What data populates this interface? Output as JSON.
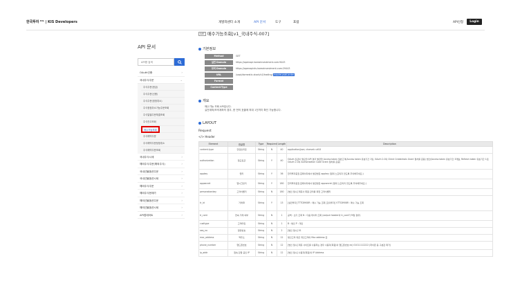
{
  "header": {
    "brand": "한국투자 ᴷᴵˢ | KIS Developers",
    "nav": [
      {
        "label": "개발자센터 소개",
        "active": false
      },
      {
        "label": "API 문서",
        "active": true
      },
      {
        "label": "도구",
        "active": false
      },
      {
        "label": "포럼",
        "active": false
      }
    ],
    "api_apply": "API신청",
    "login": "Login"
  },
  "sidebar": {
    "title": "API 문서",
    "search_placeholder": "API명 검색",
    "items": [
      {
        "label": "OAuth인증"
      },
      {
        "label": "국내주식주문",
        "expanded": true,
        "children": [
          "주식주문(현금)",
          "주식주문(신용)",
          "주식주문(정정취소)",
          "주식정정취소가능주문조회",
          "주식일별주문체결조회",
          "주식잔고조회",
          "매수가능조회",
          "주식예약주문",
          "주식예약주문정정취소",
          "주식예약주문조회"
        ]
      },
      {
        "label": "국내주식시세"
      },
      {
        "label": "해외주식주문(해외주식)"
      },
      {
        "label": "국내선물옵션주문"
      },
      {
        "label": "국내선물옵션시세"
      },
      {
        "label": "해외주식주문"
      },
      {
        "label": "해외주식현재가"
      },
      {
        "label": "해외선물옵션주문"
      },
      {
        "label": "해외선물옵션시세"
      },
      {
        "label": "API업데이트"
      }
    ],
    "selected_child": "매수가능조회"
  },
  "content": {
    "title_tag": "GET",
    "title": "매수가능조회[v1_국내주식-007]",
    "basic_info_heading": "기본정보",
    "info": [
      {
        "label": "Method",
        "value": "GET"
      },
      {
        "label": "실전 Domain",
        "value": "https://openapi.koreainvestment.com:9443"
      },
      {
        "label": "모의 Domain",
        "value": "https://openapivts.koreainvestment.com:29443"
      },
      {
        "label": "URL",
        "value": "/uapi/domestic-stock/v1/trading/",
        "highlight": "inquire-psbl-order"
      },
      {
        "label": "Format",
        "value": ""
      },
      {
        "label": "Content-Type",
        "value": ""
      }
    ],
    "summary_heading": "개요",
    "summary_lines": [
      "매수가능 조회 API입니다.",
      "실전계좌/모의계좌의 경우, 한 번의 호출에 최대 1건까지 확인 가능합니다."
    ],
    "layout_heading": "LAYOUT",
    "request_label": "Request",
    "header_label": "Header",
    "table": {
      "columns": [
        "Element",
        "한글명",
        "Type",
        "Required",
        "Length",
        "Description"
      ],
      "rows": [
        [
          "content-type",
          "컨텐츠타입",
          "String",
          "N",
          "40",
          "application/json; charset=utf-8"
        ],
        [
          "authorization",
          "접근토큰",
          "String",
          "Y",
          "40",
          "OAuth 토큰이 필요한 API 경우 발급한 Access token 일반고객(Access token 유효기간 1일, OAuth 2.0의 Client Credentials Grant 절차를 준용) 법인(Access token 유효기간 3개월, Refresh token 유효기간 1년, OAuth 2.0의 Authorization Code Grant 절차를 준용)"
        ],
        [
          "appkey",
          "앱키",
          "String",
          "Y",
          "36",
          "한국투자증권 홈페이지에서 발급받은 appkey (절대 노출되지 않도록 주의해주세요.)"
        ],
        [
          "appsecret",
          "앱시크릿키",
          "String",
          "Y",
          "180",
          "한국투자증권 홈페이지에서 발급받은 appsecret (절대 노출되지 않도록 주의해주세요.)"
        ],
        [
          "personalseckey",
          "고객식별키",
          "String",
          "N",
          "180",
          "[법인 필수] 제휴사 회원 관리를 위한 고객식별키"
        ],
        [
          "tr_id",
          "거래ID",
          "String",
          "Y",
          "13",
          "[실전투자] TTTC8908R : 매수 가능 조회 [모의투자] VTTC8908R : 매수 가능 조회"
        ],
        [
          "tr_cont",
          "연속 거래 여부",
          "String",
          "N",
          "1",
          "공백 : 초기 조회 N : 다음 데이터 조회 (output header의 tr_cont가 M일 경우)"
        ],
        [
          "custtype",
          "고객타입",
          "String",
          "N",
          "1",
          "B : 법인 P : 개인"
        ],
        [
          "seq_no",
          "일련번호",
          "String",
          "N",
          "2",
          "[법인 필수] 01"
        ],
        [
          "mac_address",
          "맥주소",
          "String",
          "N",
          "12",
          "법인고객 혹은 개인고객의 Mac address 값"
        ],
        [
          "phone_number",
          "핸드폰번호",
          "String",
          "N",
          "12",
          "[법인 필수] 제휴 사이트를 사용하는 경우 사용자(회원)의 핸드폰번호 ex) 01011112222 (하이픈 등 구분값 제거)"
        ],
        [
          "ip_addr",
          "접속 단말 공인 IP",
          "String",
          "N",
          "12",
          "[법인 필수] 사용자(회원)의 IP Address"
        ]
      ]
    }
  }
}
